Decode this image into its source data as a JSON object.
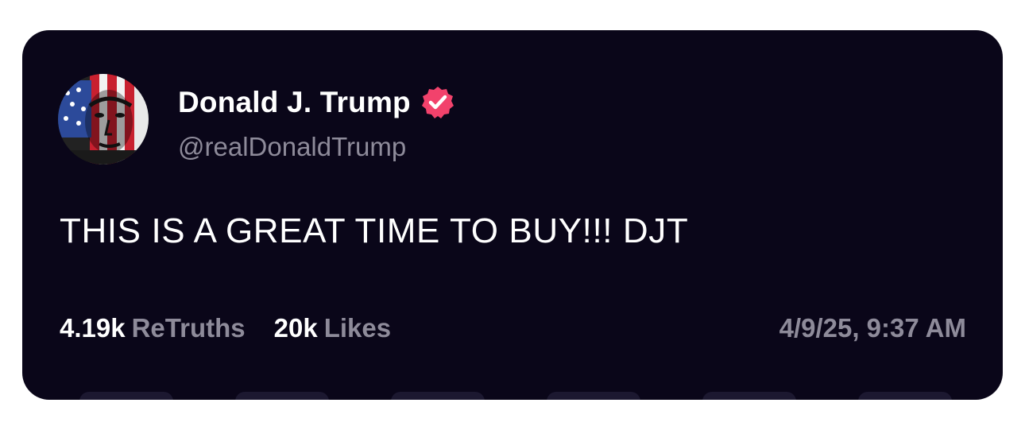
{
  "post": {
    "author": {
      "display_name": "Donald J. Trump",
      "handle": "@realDonaldTrump",
      "verified": true,
      "avatar": "american-flag-face-portrait"
    },
    "text": "THIS IS A GREAT TIME TO BUY!!! DJT",
    "stats": {
      "retruths_count": "4.19k",
      "retruths_label": "ReTruths",
      "likes_count": "20k",
      "likes_label": "Likes"
    },
    "timestamp": "4/9/25, 9:37 AM"
  },
  "colors": {
    "card_background": "#0a0619",
    "primary_text": "#ffffff",
    "secondary_text": "#8e8b9a",
    "verified_badge": "#f2426c"
  }
}
